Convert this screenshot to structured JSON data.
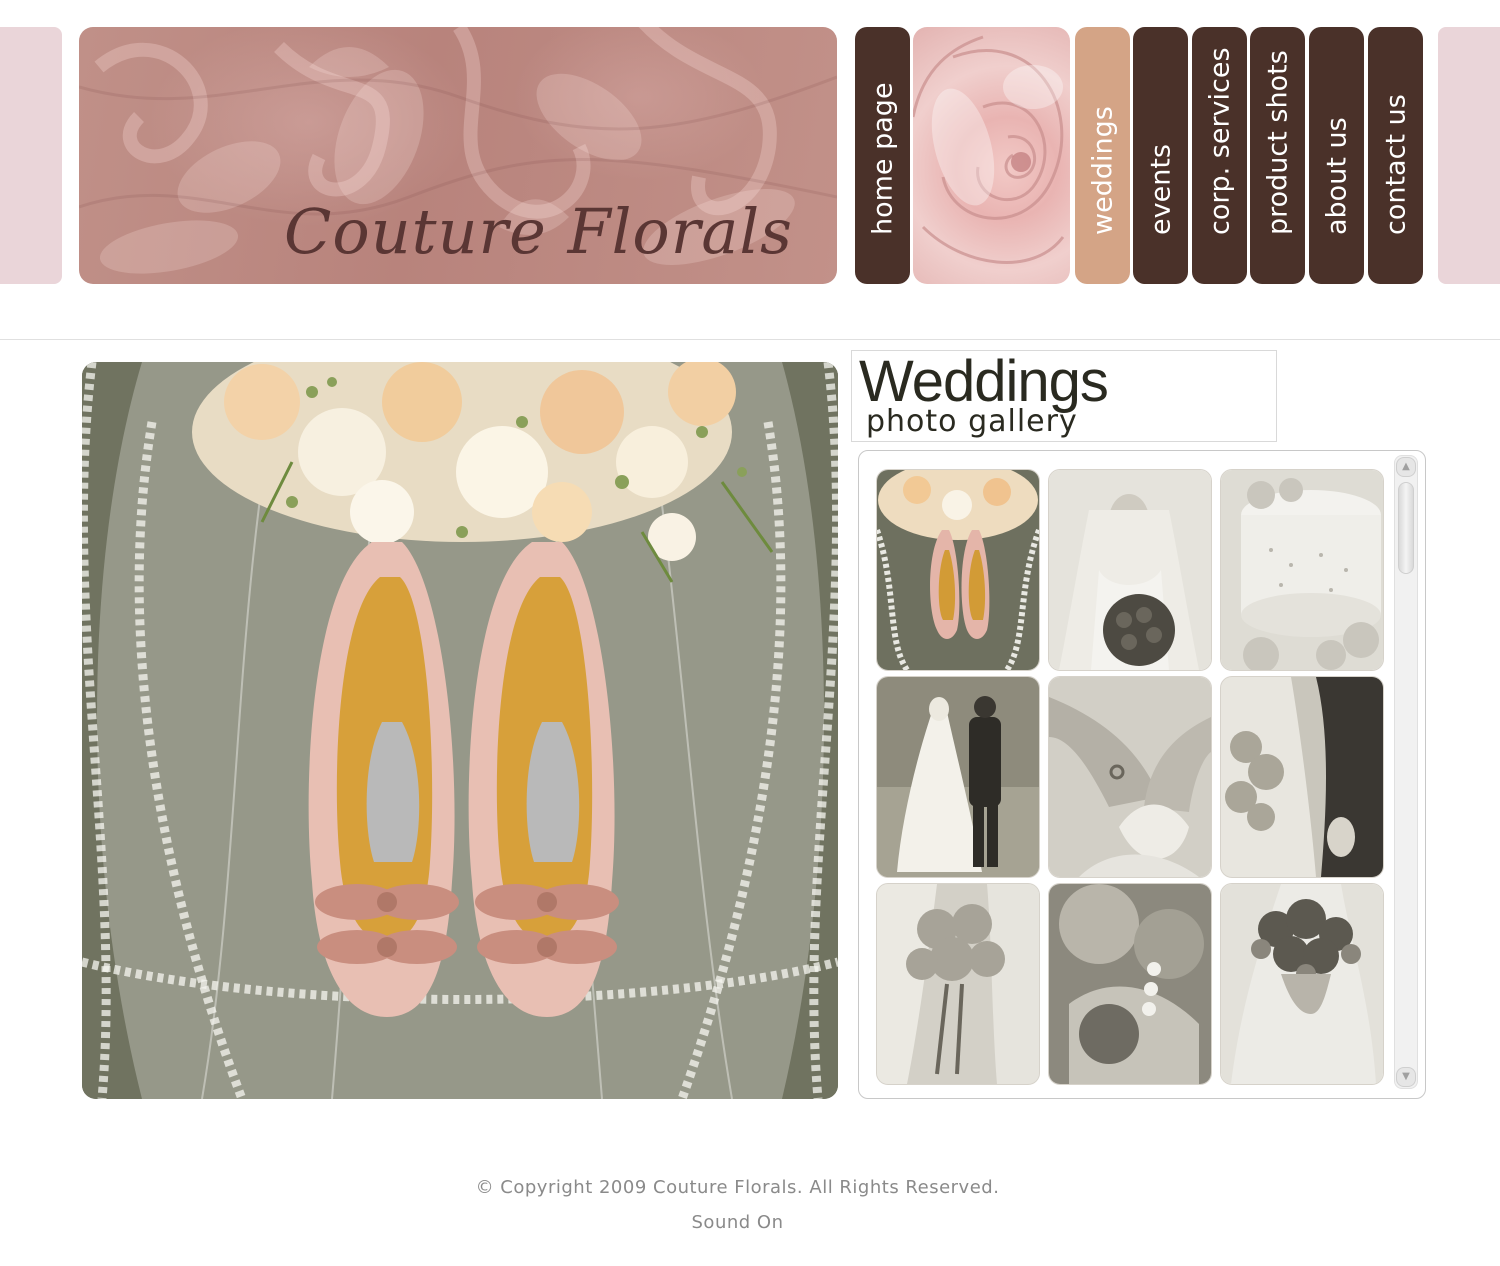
{
  "brand": {
    "logo_text": "Couture Florals"
  },
  "nav": {
    "items": [
      {
        "label": "home page",
        "active": false
      },
      {
        "label": "weddings",
        "active": true
      },
      {
        "label": "events",
        "active": false
      },
      {
        "label": "corp. services",
        "active": false
      },
      {
        "label": "product shots",
        "active": false
      },
      {
        "label": "about us",
        "active": false
      },
      {
        "label": "contact us",
        "active": false
      }
    ]
  },
  "gallery": {
    "title": "Weddings",
    "subtitle": "photo gallery",
    "thumbnails": [
      {
        "subject": "shoes-and-bouquet-on-veil",
        "style": "color"
      },
      {
        "subject": "bride-with-rose-bouquet",
        "style": "sepia"
      },
      {
        "subject": "wedding-cake-with-roses",
        "style": "sepia"
      },
      {
        "subject": "couple-walking",
        "style": "sepia"
      },
      {
        "subject": "hands-with-ring",
        "style": "sepia"
      },
      {
        "subject": "bride-and-groom-with-bouquet",
        "style": "sepia"
      },
      {
        "subject": "bride-holding-roses",
        "style": "sepia"
      },
      {
        "subject": "rose-boutonniere-with-pearls",
        "style": "sepia"
      },
      {
        "subject": "bridal-bouquet",
        "style": "sepia"
      }
    ]
  },
  "footer": {
    "copyright": "© Copyright 2009 Couture Florals. All Rights Reserved.",
    "sound": "Sound On"
  },
  "colors": {
    "nav_bg": "#4a3129",
    "nav_active": "#d4a486",
    "banner": "#b8837c",
    "side_tab": "#ead5d9"
  }
}
